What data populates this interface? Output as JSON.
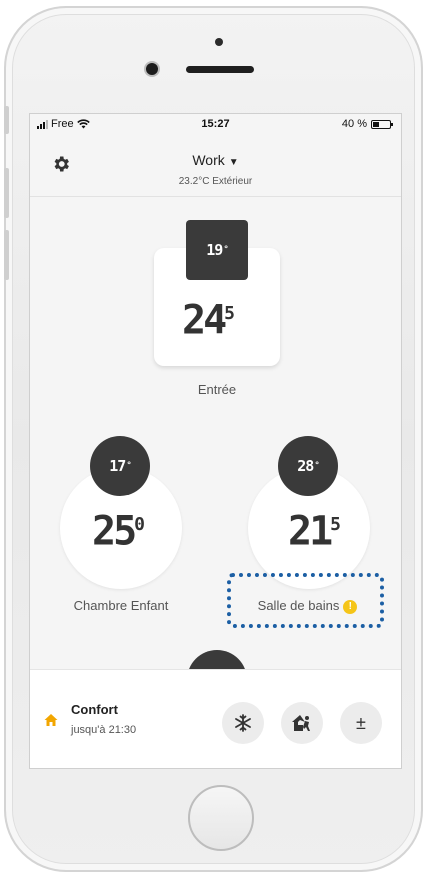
{
  "status_bar": {
    "carrier": "Free",
    "time": "15:27",
    "battery_text": "40 %",
    "battery_level_percent": 40
  },
  "header": {
    "home_name": "Work",
    "exterior_temp": "23.2°C Extérieur"
  },
  "rooms": {
    "entree": {
      "label": "Entrée",
      "setpoint": "19",
      "setpoint_unit": "°",
      "temp_int": "24",
      "temp_dec": "5"
    },
    "chambre": {
      "label": "Chambre Enfant",
      "setpoint": "17",
      "setpoint_unit": "°",
      "temp_int": "25",
      "temp_dec": "0"
    },
    "salle": {
      "label": "Salle de bains",
      "setpoint": "28",
      "setpoint_unit": "°",
      "temp_int": "21",
      "temp_dec": "5",
      "warning_glyph": "!"
    }
  },
  "footer": {
    "mode_title": "Confort",
    "mode_until": "jusqu'à 21:30",
    "plus_minus_label": "±"
  },
  "icons": {
    "settings": "gear-icon",
    "mode": "home-icon",
    "frost": "snowflake-icon",
    "away": "house-away-icon",
    "adjust": "plus-minus-icon",
    "warning": "warning-icon"
  },
  "colors": {
    "badge_dark": "#3a3a3a",
    "mode_icon": "#f2a600",
    "warning": "#f5c518",
    "highlight_border": "#1c5fa4"
  }
}
